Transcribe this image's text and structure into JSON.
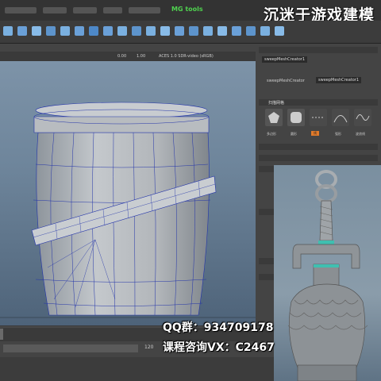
{
  "watermark": "沉迷于游戏建模",
  "menu": {
    "mg_tools": "MG tools"
  },
  "viewport": {
    "frame_start": "0.00",
    "frame_ratio": "1.00",
    "camera_label": "ACES 1.0 SDR-video (sRGB)"
  },
  "channel_box": {
    "node_name": "sweepMeshCreator1",
    "attr_label": "sweepMeshCreator",
    "attr_value": "sweepMeshCreator1",
    "section_title": "扫描网格",
    "shape_labels": [
      "多边形",
      "圆形",
      "线",
      "弧形",
      "波浪线"
    ]
  },
  "timeline": {
    "current_frame": "120"
  },
  "promo": {
    "qq_line": "QQ群：934709178",
    "vx_line": "课程咨询VX：C2467"
  },
  "colors": {
    "accent_green": "#4fd14f",
    "selected_orange": "#e07a2a",
    "wire_blue": "#2233aa"
  }
}
